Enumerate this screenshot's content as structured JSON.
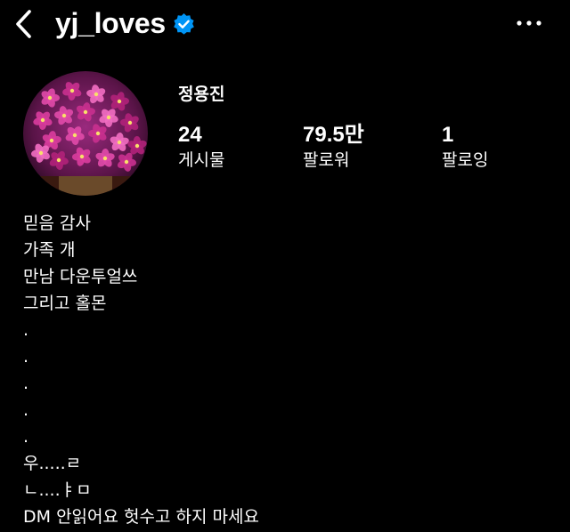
{
  "header": {
    "username": "yj_loves",
    "back_icon": "chevron-left-icon",
    "verified_icon": "verified-badge-icon",
    "more_icon": "more-horizontal-icon"
  },
  "profile": {
    "display_name": "정용진",
    "avatar_description_icon": "avatar-orchid-photo",
    "stats": [
      {
        "value": "24",
        "label": "게시물"
      },
      {
        "value": "79.5만",
        "label": "팔로워"
      },
      {
        "value": "1",
        "label": "팔로잉"
      }
    ],
    "bio_lines": [
      "믿음 감사",
      "가족 개",
      "만남 다운투얼쓰",
      "그리고 홀몬",
      ".",
      ".",
      ".",
      ".",
      ".",
      "우.....ㄹ",
      "ㄴ....ㅑㅁ",
      "DM 안읽어요 헛수고 하지 마세요"
    ]
  },
  "colors": {
    "background": "#000000",
    "text": "#ffffff",
    "verified_blue": "#0095f6"
  }
}
